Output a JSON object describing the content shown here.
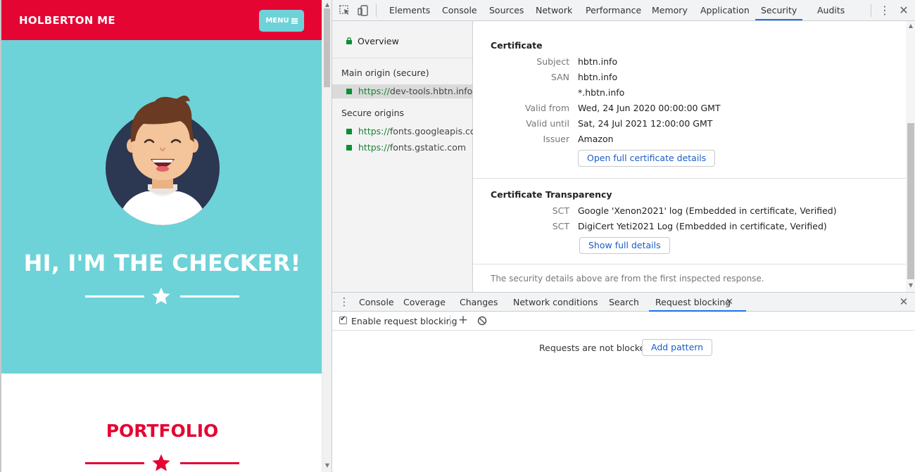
{
  "site": {
    "brand": "HOLBERTON ME",
    "menu_label": "MENU",
    "hero_title": "HI, I'M THE CHECKER!",
    "portfolio_title": "PORTFOLIO",
    "colors": {
      "nav": "#e50533",
      "hero": "#6dd3d8",
      "accent": "#e50533"
    }
  },
  "devtools": {
    "tabs": [
      "Elements",
      "Console",
      "Sources",
      "Network",
      "Performance",
      "Memory",
      "Application",
      "Security",
      "Audits"
    ],
    "active_tab": "Security",
    "sidebar": {
      "overview": "Overview",
      "main_origin_heading": "Main origin (secure)",
      "main_origin": {
        "scheme": "https://",
        "host": "dev-tools.hbtn.info"
      },
      "secure_origins_heading": "Secure origins",
      "secure_origins": [
        {
          "scheme": "https://",
          "host": "fonts.googleapis.com"
        },
        {
          "scheme": "https://",
          "host": "fonts.gstatic.com"
        }
      ]
    },
    "certificate": {
      "title": "Certificate",
      "rows": [
        {
          "key": "Subject",
          "value": "hbtn.info"
        },
        {
          "key": "SAN",
          "value": "hbtn.info"
        },
        {
          "key": "",
          "value": "*.hbtn.info"
        },
        {
          "key": "Valid from",
          "value": "Wed, 24 Jun 2020 00:00:00 GMT"
        },
        {
          "key": "Valid until",
          "value": "Sat, 24 Jul 2021 12:00:00 GMT"
        },
        {
          "key": "Issuer",
          "value": "Amazon"
        }
      ],
      "button": "Open full certificate details"
    },
    "transparency": {
      "title": "Certificate Transparency",
      "rows": [
        {
          "key": "SCT",
          "value": "Google 'Xenon2021' log (Embedded in certificate, Verified)"
        },
        {
          "key": "SCT",
          "value": "DigiCert Yeti2021 Log (Embedded in certificate, Verified)"
        }
      ],
      "button": "Show full details"
    },
    "footer_note": "The security details above are from the first inspected response.",
    "drawer": {
      "tabs": [
        "Console",
        "Coverage",
        "Changes",
        "Network conditions",
        "Search",
        "Request blocking"
      ],
      "active_tab": "Request blocking",
      "enable_label": "Enable request blocking",
      "enable_checked": true,
      "empty_message": "Requests are not blocked.",
      "add_pattern": "Add pattern"
    }
  }
}
